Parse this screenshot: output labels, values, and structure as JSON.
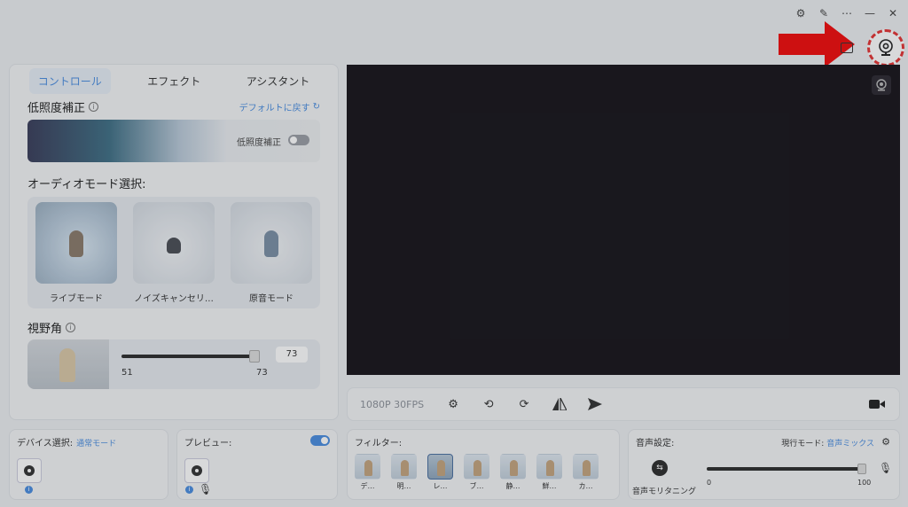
{
  "window": {
    "controls": [
      "⚙",
      "✎",
      "⋯",
      "—",
      "✕"
    ]
  },
  "tabs": [
    {
      "label": "コントロール",
      "active": true
    },
    {
      "label": "エフェクト",
      "active": false
    },
    {
      "label": "アシスタント",
      "active": false
    }
  ],
  "low_light": {
    "title": "低照度補正",
    "reset_label": "デフォルトに戻す",
    "toggle_label": "低照度補正",
    "enabled": false
  },
  "audio_mode": {
    "title": "オーディオモード選択:",
    "modes": [
      {
        "label": "ライブモード",
        "selected": true
      },
      {
        "label": "ノイズキャンセリ…",
        "selected": false
      },
      {
        "label": "原音モード",
        "selected": false
      }
    ]
  },
  "fov": {
    "title": "視野角",
    "value": "73",
    "min": "51",
    "max": "73",
    "level": 1.0
  },
  "control_bar": {
    "resolution": "1080P 30FPS"
  },
  "device": {
    "title": "デバイス選択:",
    "mode": "通常モード"
  },
  "preview_panel": {
    "title": "プレビュー:",
    "enabled": true
  },
  "filters": {
    "title": "フィルター:",
    "items": [
      {
        "label": "デ…",
        "selected": false
      },
      {
        "label": "明…",
        "selected": false
      },
      {
        "label": "レ…",
        "selected": true
      },
      {
        "label": "ブ…",
        "selected": false
      },
      {
        "label": "静…",
        "selected": false
      },
      {
        "label": "鮮…",
        "selected": false
      },
      {
        "label": "カ…",
        "selected": false
      }
    ]
  },
  "audio_settings": {
    "title": "音声設定:",
    "current_mode_label": "現行モード:",
    "current_mode_value": "音声ミックス",
    "monitoring_label": "音声モリタニング",
    "volume_min": "0",
    "volume_max": "100",
    "level": 1.0
  },
  "colors": {
    "accent": "#4a8de0",
    "highlight": "#e53333",
    "preview_bg": "#161319"
  }
}
